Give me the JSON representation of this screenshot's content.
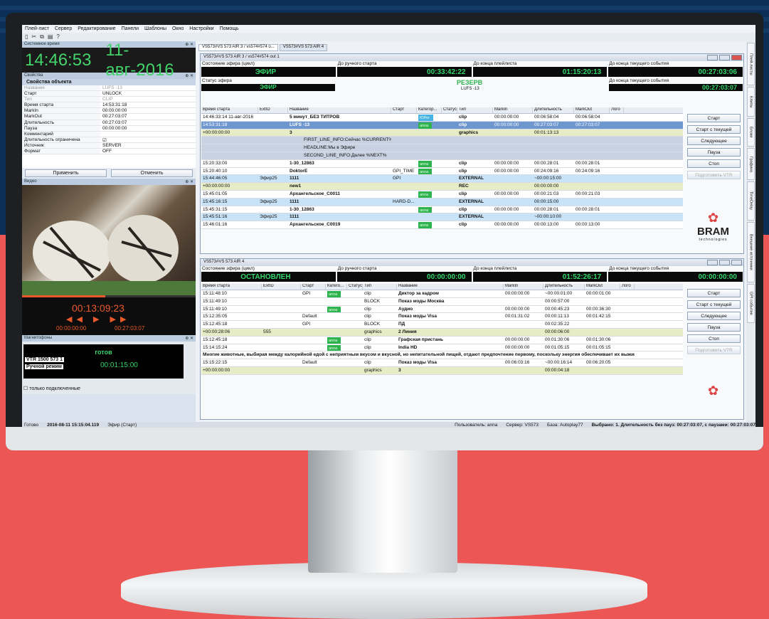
{
  "menu": [
    "Плей-лист",
    "Сервер",
    "Редактирование",
    "Панели",
    "Шаблоны",
    "Окно",
    "Настройки",
    "Помощь"
  ],
  "toolbar_icons": [
    "new-icon",
    "cut-icon",
    "copy-icon",
    "paste-icon",
    "help-icon"
  ],
  "sys_time": {
    "panel": "Системное время",
    "time": "14:46:53",
    "date": "11-авг-2016"
  },
  "props": {
    "panel": "Свойства",
    "header": "Свойства объекта",
    "rows": [
      {
        "k": "Название",
        "v": "LUFS -13",
        "grey": true
      },
      {
        "k": "Старт",
        "v": "UNLOCK"
      },
      {
        "k": "Тип",
        "v": "CLIP",
        "grey": true
      },
      {
        "k": "Время старта",
        "v": "14:53:31:18"
      },
      {
        "k": "MarkIn",
        "v": "00:00:00:00"
      },
      {
        "k": "MarkOut",
        "v": "00:27:03:07"
      },
      {
        "k": "Длительность",
        "v": "00:27:03:07"
      },
      {
        "k": "Пауза",
        "v": "00:00:00:00"
      },
      {
        "k": "Комментарий",
        "v": ""
      },
      {
        "k": "Длительность ограничена",
        "v": "☑"
      },
      {
        "k": "Источник",
        "v": "SERVER"
      },
      {
        "k": "Формат",
        "v": "OFF"
      }
    ],
    "apply": "Применить",
    "cancel": "Отменить"
  },
  "video": {
    "panel": "Видео",
    "tc": "00:13:09:23",
    "in": "00:00:00:00",
    "out": "00:27:03:07"
  },
  "vtr": {
    "panel": "Магнитофоны",
    "status": "готов",
    "name": "VTR 1500 573 1",
    "mode": "Ручной режим",
    "tc": "00:01:15:00",
    "only_connected": "только подключенные"
  },
  "tabs": [
    "VS573#VS 573 AIR 3 / vs574#574 o...",
    "VS573#VS 573 AIR 4"
  ],
  "right_tabs": [
    "Плей-листы",
    "Клипы",
    "Блоки",
    "Графика",
    "TimeDelay",
    "Внешние источники",
    "GPI события"
  ],
  "pl1": {
    "title": "VS573#VS 573 AIR 3 / vs574#574 out 1",
    "heads": [
      "Состояние эфира (цикл)",
      "До ручного старта",
      "До конца плейлиста",
      "До конца текущего события"
    ],
    "vals": [
      "ЭФИР",
      "00:33:42:22",
      "01:15:20:13",
      "00:27:03:06"
    ],
    "heads2": [
      "Статус эфира",
      "",
      "",
      "До конца текущего события"
    ],
    "vals2": [
      "ЭФИР",
      "00:27:03:07"
    ],
    "reserve": "РЕЗЕРВ",
    "reserve_sub": "LUFS -13",
    "cols": [
      "Время старта",
      "ExtID",
      "Название",
      "Старт",
      "Категор...",
      "Статус",
      "Тип",
      "MarkIn",
      "Длительность",
      "MarkOut",
      "Лого"
    ],
    "rows": [
      {
        "t": "14:46:33:14  11-авг-2016",
        "id": "",
        "n": "5 минут_БЕЗ ТИТРОВ",
        "s": "",
        "c": "ЮРег",
        "cb": true,
        "ty": "clip",
        "mi": "00:00:00:00",
        "d": "00:06:58:04",
        "mo": "00:06:58:04",
        "cls": ""
      },
      {
        "t": "14:53:31:18",
        "id": "",
        "n": "LUFS -13",
        "s": "",
        "c": "anna",
        "ty": "clip",
        "mi": "00:00:00:00",
        "d": "00:27:03:07",
        "mo": "00:27:03:07",
        "cls": "sel"
      },
      {
        "t": "+00:00:00:00",
        "id": "",
        "n": "3",
        "s": "",
        "c": "",
        "ty": "graphics",
        "mi": "",
        "d": "00:01:13:13",
        "mo": "",
        "cls": "green"
      },
      {
        "t": "",
        "id": "",
        "n": "FIRST_LINE_INFO:Сейчас %CURRENT%",
        "s": "",
        "c": "",
        "ty": "",
        "mi": "",
        "d": "",
        "mo": "",
        "cls": "sub"
      },
      {
        "t": "",
        "id": "",
        "n": "HEADLINE:Мы в Эфире",
        "s": "",
        "c": "",
        "ty": "",
        "mi": "",
        "d": "",
        "mo": "",
        "cls": "sub"
      },
      {
        "t": "",
        "id": "",
        "n": "SECOND_LINE_INFO:Далее  %NEXT%",
        "s": "",
        "c": "",
        "ty": "",
        "mi": "",
        "d": "",
        "mo": "",
        "cls": "sub"
      },
      {
        "t": "15:20:33:00",
        "id": "",
        "n": "1-30_12863",
        "s": "",
        "c": "anna",
        "ty": "clip",
        "mi": "00:00:00:00",
        "d": "00:00:28:01",
        "mo": "00:00:28:01",
        "cls": ""
      },
      {
        "t": "15:20:40:10",
        "id": "",
        "n": "DoktorE",
        "s": "GPI_TIME",
        "c": "anna",
        "ty": "clip",
        "mi": "00:00:00:00",
        "d": "00:24:09:16",
        "mo": "00:24:09:16",
        "cls": ""
      },
      {
        "t": "15:44:46:05",
        "id": "Эфир25",
        "n": "1111",
        "s": "GPI",
        "c": "",
        "ty": "EXTERNAL",
        "mi": "",
        "d": "~00:00:15:00",
        "mo": "",
        "cls": "blue"
      },
      {
        "t": "+00:00:00:00",
        "id": "",
        "n": "new1",
        "s": "",
        "c": "",
        "ty": "REC",
        "mi": "",
        "d": "00:00:00:00",
        "mo": "",
        "cls": "green"
      },
      {
        "t": "15:45:01:05",
        "id": "",
        "n": "Архангельское_C0011",
        "s": "",
        "c": "anna",
        "ty": "clip",
        "mi": "00:00:00:00",
        "d": "00:00:21:03",
        "mo": "00:00:21:03",
        "cls": ""
      },
      {
        "t": "15:45:16:15",
        "id": "Эфир25",
        "n": "1111",
        "s": "HARD-D...",
        "c": "",
        "ty": "EXTERNAL",
        "mi": "",
        "d": "00:00:15:00",
        "mo": "",
        "cls": "blue"
      },
      {
        "t": "15:45:31:15",
        "id": "",
        "n": "1-30_12863",
        "s": "",
        "c": "anna",
        "ty": "clip",
        "mi": "00:00:00:00",
        "d": "00:00:28:01",
        "mo": "00:00:28:01",
        "cls": ""
      },
      {
        "t": "15:45:51:16",
        "id": "Эфир25",
        "n": "1111",
        "s": "",
        "c": "",
        "ty": "EXTERNAL",
        "mi": "",
        "d": "~00:00:10:00",
        "mo": "",
        "cls": "blue"
      },
      {
        "t": "15:46:01:16",
        "id": "",
        "n": "Архангельское_C0019",
        "s": "",
        "c": "anna",
        "ty": "clip",
        "mi": "00:00:00:00",
        "d": "00:00:13:00",
        "mo": "00:00:13:00",
        "cls": ""
      }
    ],
    "buttons": [
      "Старт",
      "Старт с текущей",
      "Следующее",
      "Пауза",
      "Стоп",
      "Подготовить VTR"
    ]
  },
  "pl2": {
    "title": "VS573#VS 573 AIR 4",
    "heads": [
      "Состояние эфира (цикл)",
      "До ручного старта",
      "До конца плейлиста",
      "До конца текущего события"
    ],
    "vals": [
      "ОСТАНОВЛЕН",
      "00:00:00:00",
      "01:52:26:17",
      "00:00:00:00"
    ],
    "cols": [
      "Время старта",
      "ExtID",
      "Старт",
      "Катего...",
      "Статус",
      "Тип",
      "Название",
      "MarkIn",
      "Длительность",
      "MarkOut",
      "Лого"
    ],
    "rows": [
      {
        "t": "15:11:48:10",
        "id": "",
        "s": "GPI",
        "c": "anna",
        "ty": "clip",
        "n": "Диктор за кадром",
        "mi": "00:00:00:00",
        "d": "~00:00:01:00",
        "mo": "00:00:01:00",
        "cls": ""
      },
      {
        "t": "15:11:49:10",
        "id": "",
        "s": "",
        "c": "",
        "ty": "BLOCK",
        "n": "Показ моды Москва",
        "mi": "",
        "d": "00:00:57:00",
        "mo": "",
        "cls": ""
      },
      {
        "t": "15:11:49:10",
        "id": "",
        "s": "",
        "c": "anna",
        "ty": "clip",
        "n": "Аудио",
        "mi": "00:00:00:00",
        "d": "00:00:45:23",
        "mo": "00:00:36:30",
        "cls": ""
      },
      {
        "t": "15:12:35:05",
        "id": "",
        "s": "Default",
        "c": "",
        "ty": "clip",
        "n": "Показ моды Visa",
        "mi": "00:01:31:02",
        "d": "00:00:11:13",
        "mo": "00:01:42:15",
        "cls": ""
      },
      {
        "t": "15:12:45:18",
        "id": "",
        "s": "GPI",
        "c": "",
        "ty": "BLOCK",
        "n": "ПД",
        "mi": "",
        "d": "00:02:35:22",
        "mo": "",
        "cls": ""
      },
      {
        "t": "+00:00:28:06",
        "id": "555",
        "s": "",
        "c": "",
        "ty": "graphics",
        "n": "2 Линия",
        "mi": "",
        "d": "00:00:06:00",
        "mo": "",
        "cls": "green"
      },
      {
        "t": "15:12:45:18",
        "id": "",
        "s": "",
        "c": "anna",
        "ty": "clip",
        "n": "Графская пристань",
        "mi": "00:00:00:00",
        "d": "00:01:30:06",
        "mo": "00:01:30:06",
        "cls": ""
      },
      {
        "t": "15:14:15:24",
        "id": "",
        "s": "",
        "c": "anna",
        "ty": "clip",
        "n": "India HD",
        "mi": "00:00:00:00",
        "d": "00:01:05:15",
        "mo": "00:01:05:15",
        "cls": ""
      },
      {
        "t": "Многие животные, выбирая между калорийной едой с неприятным вкусом и вкусной, но непитательной пищей, отдают предпочтение первому, поскольку энергия обеспечивает их выживан...",
        "id": "",
        "s": "",
        "c": "",
        "ty": "",
        "n": "",
        "mi": "",
        "d": "",
        "mo": "",
        "cls": "note"
      },
      {
        "t": "15:15:22:15",
        "id": "",
        "s": "Default",
        "c": "",
        "ty": "clip",
        "n": "Показ моды Visa",
        "mi": "00:06:03:16",
        "d": "~00:00:16:14",
        "mo": "00:06:20:05",
        "cls": ""
      },
      {
        "t": "+00:00:00:00",
        "id": "",
        "s": "",
        "c": "",
        "ty": "graphics",
        "n": "3",
        "mi": "",
        "d": "00:00:04:18",
        "mo": "",
        "cls": "green"
      }
    ],
    "buttons": [
      "Старт",
      "Старт с текущей",
      "Следующее",
      "Пауза",
      "Стоп",
      "Подготовить VTR"
    ]
  },
  "brand": {
    "name": "BRAM",
    "sub": "technologies"
  },
  "statusbar": {
    "s0": "Готово",
    "time": "2016-08-11 15:15:04.119",
    "mode": "Эфир (Старт)",
    "user": "Пользователь: anna",
    "server": "Сервер: VS573",
    "db": "База: Autoplay77",
    "selected": "Выбрано: 1. Длительность без пауз: 00:27:03:07, с паузами: 00:27:03:07"
  }
}
